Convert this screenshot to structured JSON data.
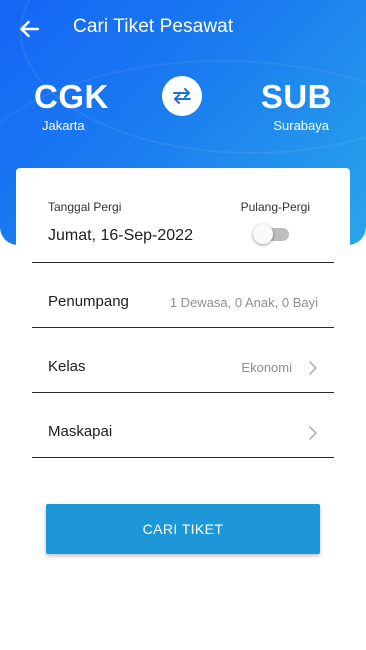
{
  "header": {
    "title": "Cari Tiket Pesawat",
    "back_icon": "arrow-left-icon"
  },
  "route": {
    "origin_code": "CGK",
    "origin_city": "Jakarta",
    "destination_code": "SUB",
    "destination_city": "Surabaya",
    "swap_icon": "swap-arrows-icon"
  },
  "form": {
    "date_label": "Tanggal Pergi",
    "date_value": "Jumat, 16-Sep-2022",
    "round_trip_label": "Pulang-Pergi",
    "round_trip_enabled": false,
    "passengers_label": "Penumpang",
    "passengers_value": "1 Dewasa, 0 Anak, 0 Bayi",
    "class_label": "Kelas",
    "class_value": "Ekonomi",
    "airline_label": "Maskapai",
    "airline_value": ""
  },
  "actions": {
    "search_label": "CARI TIKET"
  },
  "colors": {
    "header_gradient_start": "#1565f5",
    "header_gradient_end": "#2aa6ea",
    "primary_button": "#1e97d9",
    "swap_icon_color": "#1e6fd9"
  }
}
